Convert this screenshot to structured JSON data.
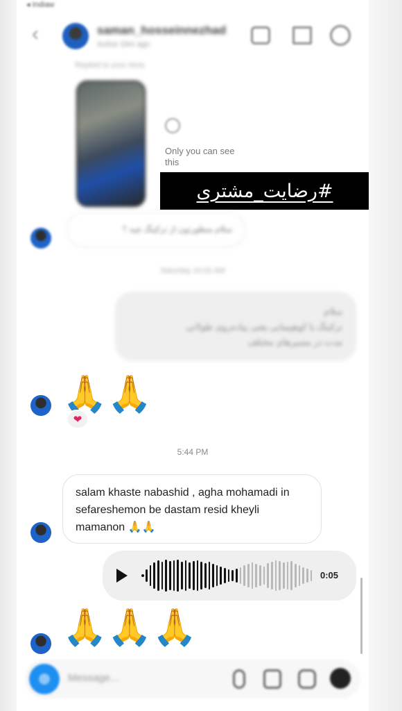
{
  "status_bar": {
    "back_label": "◂ Indiaw"
  },
  "header": {
    "back_icon": "chevron-left-icon",
    "username": "saman_hosseinnezhad",
    "active_status": "Active 16m ago",
    "icons": [
      "video-icon",
      "flag-icon",
      "info-icon"
    ]
  },
  "story_reply": {
    "label": "Replied to your story",
    "only_you_text": "Only you can see this",
    "clock_icon": "clock-icon"
  },
  "banner": {
    "text": "#رضایت_مشتری",
    "bg": "#000000",
    "fg": "#ffffff"
  },
  "messages": {
    "m1": "سلام منظورتون از ترکینگ چیه ؟",
    "ts1": "Saturday 10:02 AM",
    "m2_line1": "سلام",
    "m2_line2": "ترکینگ یا کوهپیمایی یعنی پیاده‌روی طولانی",
    "m2_line3": "مدت در مسیرهای مختلف",
    "praying1": "🙏🙏",
    "reaction": "❤",
    "ts2": "5:44 PM",
    "m3": "salam khaste nabashid , agha mohamadi in sefareshemon be dastam resid kheyli mamanon 🙏🙏",
    "voice_duration": "0:05",
    "praying2": "🙏🙏🙏"
  },
  "composer": {
    "placeholder": "Message...",
    "icons": [
      "camera-icon",
      "mic-icon",
      "gallery-icon",
      "sticker-icon",
      "plus-icon"
    ]
  },
  "colors": {
    "accent": "#1e8ff0",
    "bubble_out": "#efefef",
    "heart": "#e0245e"
  }
}
